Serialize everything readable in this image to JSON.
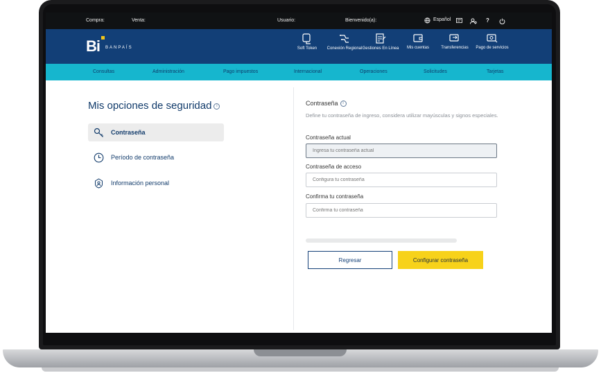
{
  "topbar": {
    "compra": "Compra:",
    "venta": "Venta:",
    "usuario": "Usuario:",
    "bienvenido": "Bienvenido(a):",
    "language": "Español"
  },
  "brand": {
    "logo": "Bi",
    "name": "BANPAÍS",
    "accent": "#f2c518"
  },
  "nav": [
    {
      "label": "Soft Token",
      "icon": "soft-token-icon"
    },
    {
      "label": "Conexión Regional",
      "icon": "conexion-regional-icon"
    },
    {
      "label": "Gestiones En Línea",
      "icon": "gestiones-icon"
    },
    {
      "label": "Mis cuentas",
      "icon": "wallet-icon"
    },
    {
      "label": "Transferencias",
      "icon": "transfer-icon"
    },
    {
      "label": "Pago de servicios",
      "icon": "services-icon"
    }
  ],
  "subnav": [
    "Consultas",
    "Administración",
    "Pago impuestos",
    "Internacional",
    "Operaciones",
    "Solicitudes",
    "Tarjetas"
  ],
  "page": {
    "title": "Mis opciones de seguridad"
  },
  "menu": [
    {
      "label": "Contraseña",
      "active": true
    },
    {
      "label": "Período de contraseña",
      "active": false
    },
    {
      "label": "Información personal",
      "active": false
    }
  ],
  "form": {
    "title": "Contraseña",
    "description": "Define tu contraseña de ingreso, considera utilizar mayúsculas y signos especiales.",
    "fields": [
      {
        "label": "Contraseña actual",
        "placeholder": "Ingresa tu contraseña actual"
      },
      {
        "label": "Contraseña de acceso",
        "placeholder": "Configura tu contraseña"
      },
      {
        "label": "Confirma tu contraseña",
        "placeholder": "Confirma tu contraseña"
      }
    ],
    "back_label": "Regresar",
    "submit_label": "Configurar contraseña"
  },
  "colors": {
    "navy": "#123f77",
    "cyan": "#16b6ce",
    "yellow": "#f7d21a"
  }
}
